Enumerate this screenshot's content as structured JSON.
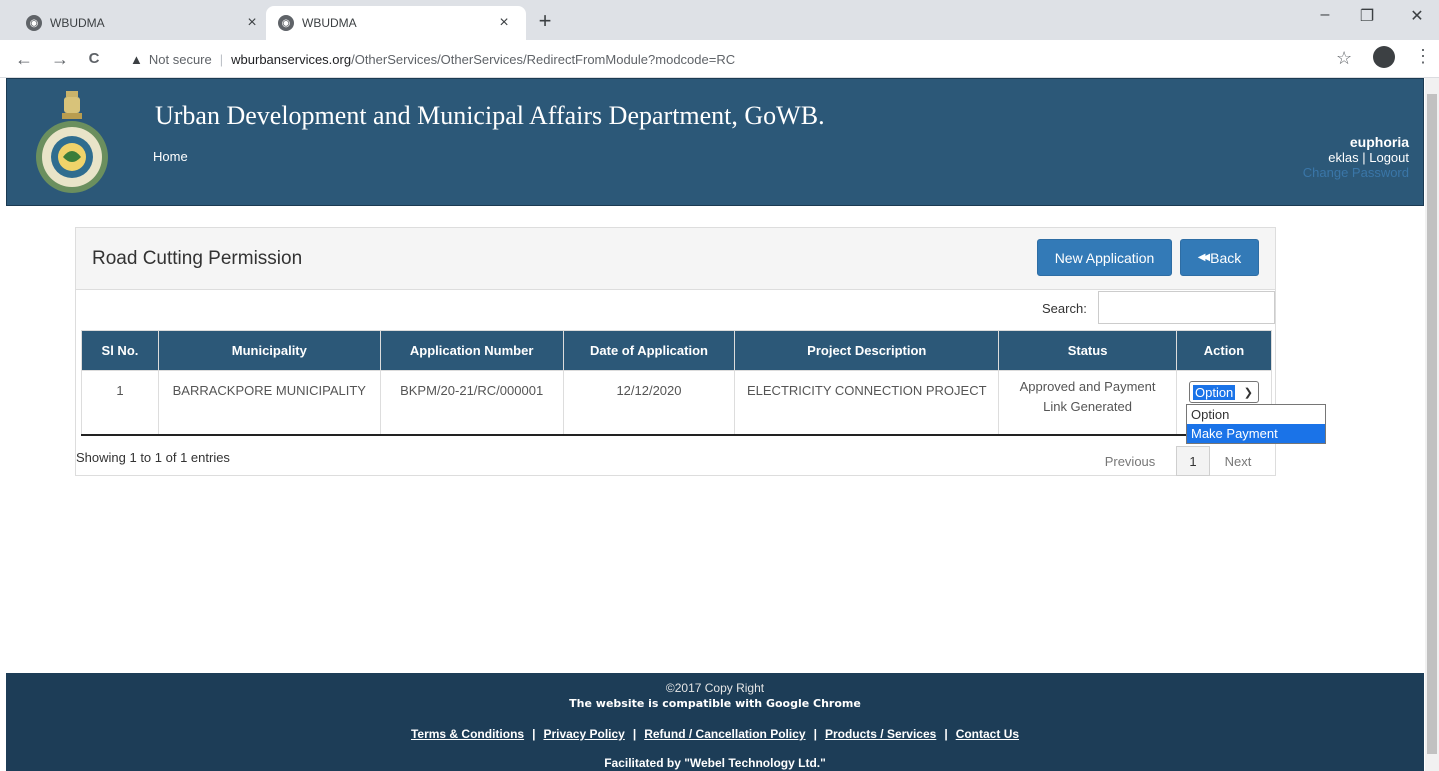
{
  "browser": {
    "tabs": [
      {
        "title": "WBUDMA",
        "close": "×"
      },
      {
        "title": "WBUDMA",
        "close": "×"
      }
    ],
    "new_tab": "+",
    "window_controls": {
      "minimize": "–",
      "maximize": "❐",
      "close": "✕"
    },
    "nav": {
      "back": "←",
      "forward": "→",
      "reload": "C"
    },
    "address": {
      "security_icon": "▲",
      "security_text": "Not secure",
      "separator": "|",
      "host": "wburbanservices.org",
      "path": "/OtherServices/OtherServices/RedirectFromModule?modcode=RC"
    },
    "star": "☆",
    "kebab": "⋮"
  },
  "header": {
    "title": "Urban Development and Municipal Affairs Department, GoWB.",
    "home": "Home",
    "user": "euphoria",
    "user_sub": "eklas",
    "links_sep": " | ",
    "logout": "Logout",
    "change_password": "Change Password"
  },
  "panel": {
    "title": "Road Cutting Permission",
    "new_application": "New Application",
    "back_icon": "◀◀",
    "back": "Back",
    "search_label": "Search:",
    "search_value": ""
  },
  "table": {
    "columns": [
      "Sl No.",
      "Municipality",
      "Application Number",
      "Date of Application",
      "Project Description",
      "Status",
      "Action"
    ],
    "rows": [
      {
        "sl": "1",
        "municipality": "BARRACKPORE MUNICIPALITY",
        "application_number": "BKPM/20-21/RC/000001",
        "date": "12/12/2020",
        "project": "ELECTRICITY CONNECTION PROJECT",
        "status_line1": "Approved and Payment",
        "status_line2": "Link Generated",
        "action_selected": "Option"
      }
    ],
    "action_options": [
      "Option",
      "Make Payment"
    ],
    "highlighted_option": "Make Payment",
    "info": "Showing 1 to 1 of 1 entries",
    "pagination": {
      "previous": "Previous",
      "page": "1",
      "next": "Next"
    }
  },
  "footer": {
    "copyright": "©2017 Copy Right",
    "compat": "The website is compatible with Google Chrome",
    "links": [
      "Terms & Conditions",
      "Privacy Policy",
      "Refund / Cancellation Policy",
      "Products / Services",
      "Contact Us"
    ],
    "link_sep": "|",
    "facilitated": "Facilitated by \"Webel Technology Ltd.\""
  },
  "colors": {
    "header_bg": "#2c5878",
    "primary_button": "#337ab7",
    "footer_bg": "#1d3d57",
    "selection_blue": "#1a73e8"
  },
  "icons": [
    "globe-icon",
    "close-icon",
    "plus-icon",
    "back-arrow-icon",
    "forward-arrow-icon",
    "reload-icon",
    "warning-icon",
    "star-icon",
    "profile-icon",
    "kebab-menu-icon",
    "emblem-icon",
    "back-icon",
    "chevron-down-icon"
  ]
}
